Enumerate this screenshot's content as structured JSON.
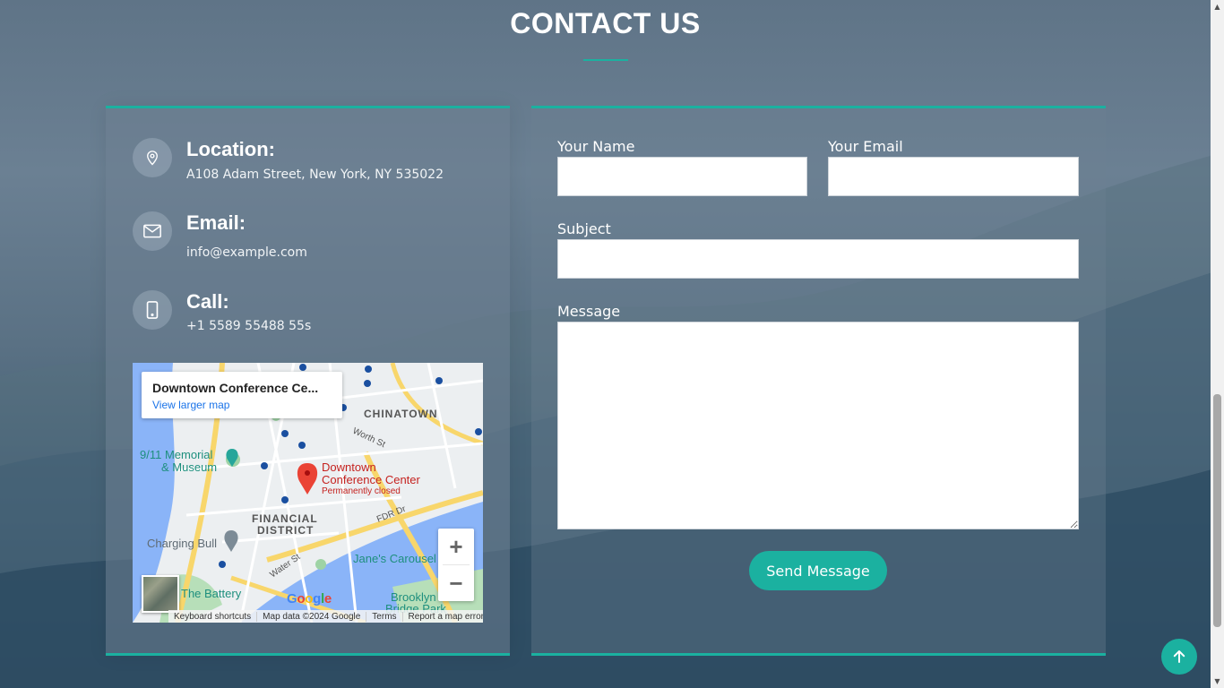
{
  "section": {
    "title": "CONTACT US"
  },
  "info": {
    "location": {
      "heading": "Location:",
      "text": "A108 Adam Street, New York, NY 535022",
      "icon": "map-pin-icon"
    },
    "email": {
      "heading": "Email:",
      "text": "info@example.com",
      "icon": "envelope-icon"
    },
    "call": {
      "heading": "Call:",
      "text": "+1 5589 55488 55s",
      "icon": "phone-icon"
    }
  },
  "map": {
    "card_title": "Downtown Conference Ce...",
    "card_link": "View larger map",
    "place_name_1": "Downtown",
    "place_name_2": "Conference Center",
    "place_status": "Permanently closed",
    "labels": {
      "chinatown": "CHINATOWN",
      "memorial_1": "9/11 Memorial",
      "memorial_2": "& Museum",
      "financial_1": "FINANCIAL",
      "financial_2": "DISTRICT",
      "charging_bull": "Charging Bull",
      "battery": "The Battery",
      "janes": "Jane's Carousel",
      "brooklyn_1": "Brooklyn",
      "brooklyn_2": "Bridge Park",
      "fdr": "FDR Dr",
      "worth": "Worth St",
      "water": "Water St"
    },
    "zoom_in": "+",
    "zoom_out": "−",
    "google": "Google",
    "footer": {
      "shortcuts": "Keyboard shortcuts",
      "data": "Map data ©2024 Google",
      "terms": "Terms",
      "report": "Report a map error"
    }
  },
  "form": {
    "name_label": "Your Name",
    "name_value": "",
    "email_label": "Your Email",
    "email_value": "",
    "subject_label": "Subject",
    "subject_value": "",
    "message_label": "Message",
    "message_value": "",
    "submit_label": "Send Message"
  },
  "colors": {
    "accent": "#1bb1a0",
    "link": "#1a73e8",
    "pin": "#ea4335"
  }
}
